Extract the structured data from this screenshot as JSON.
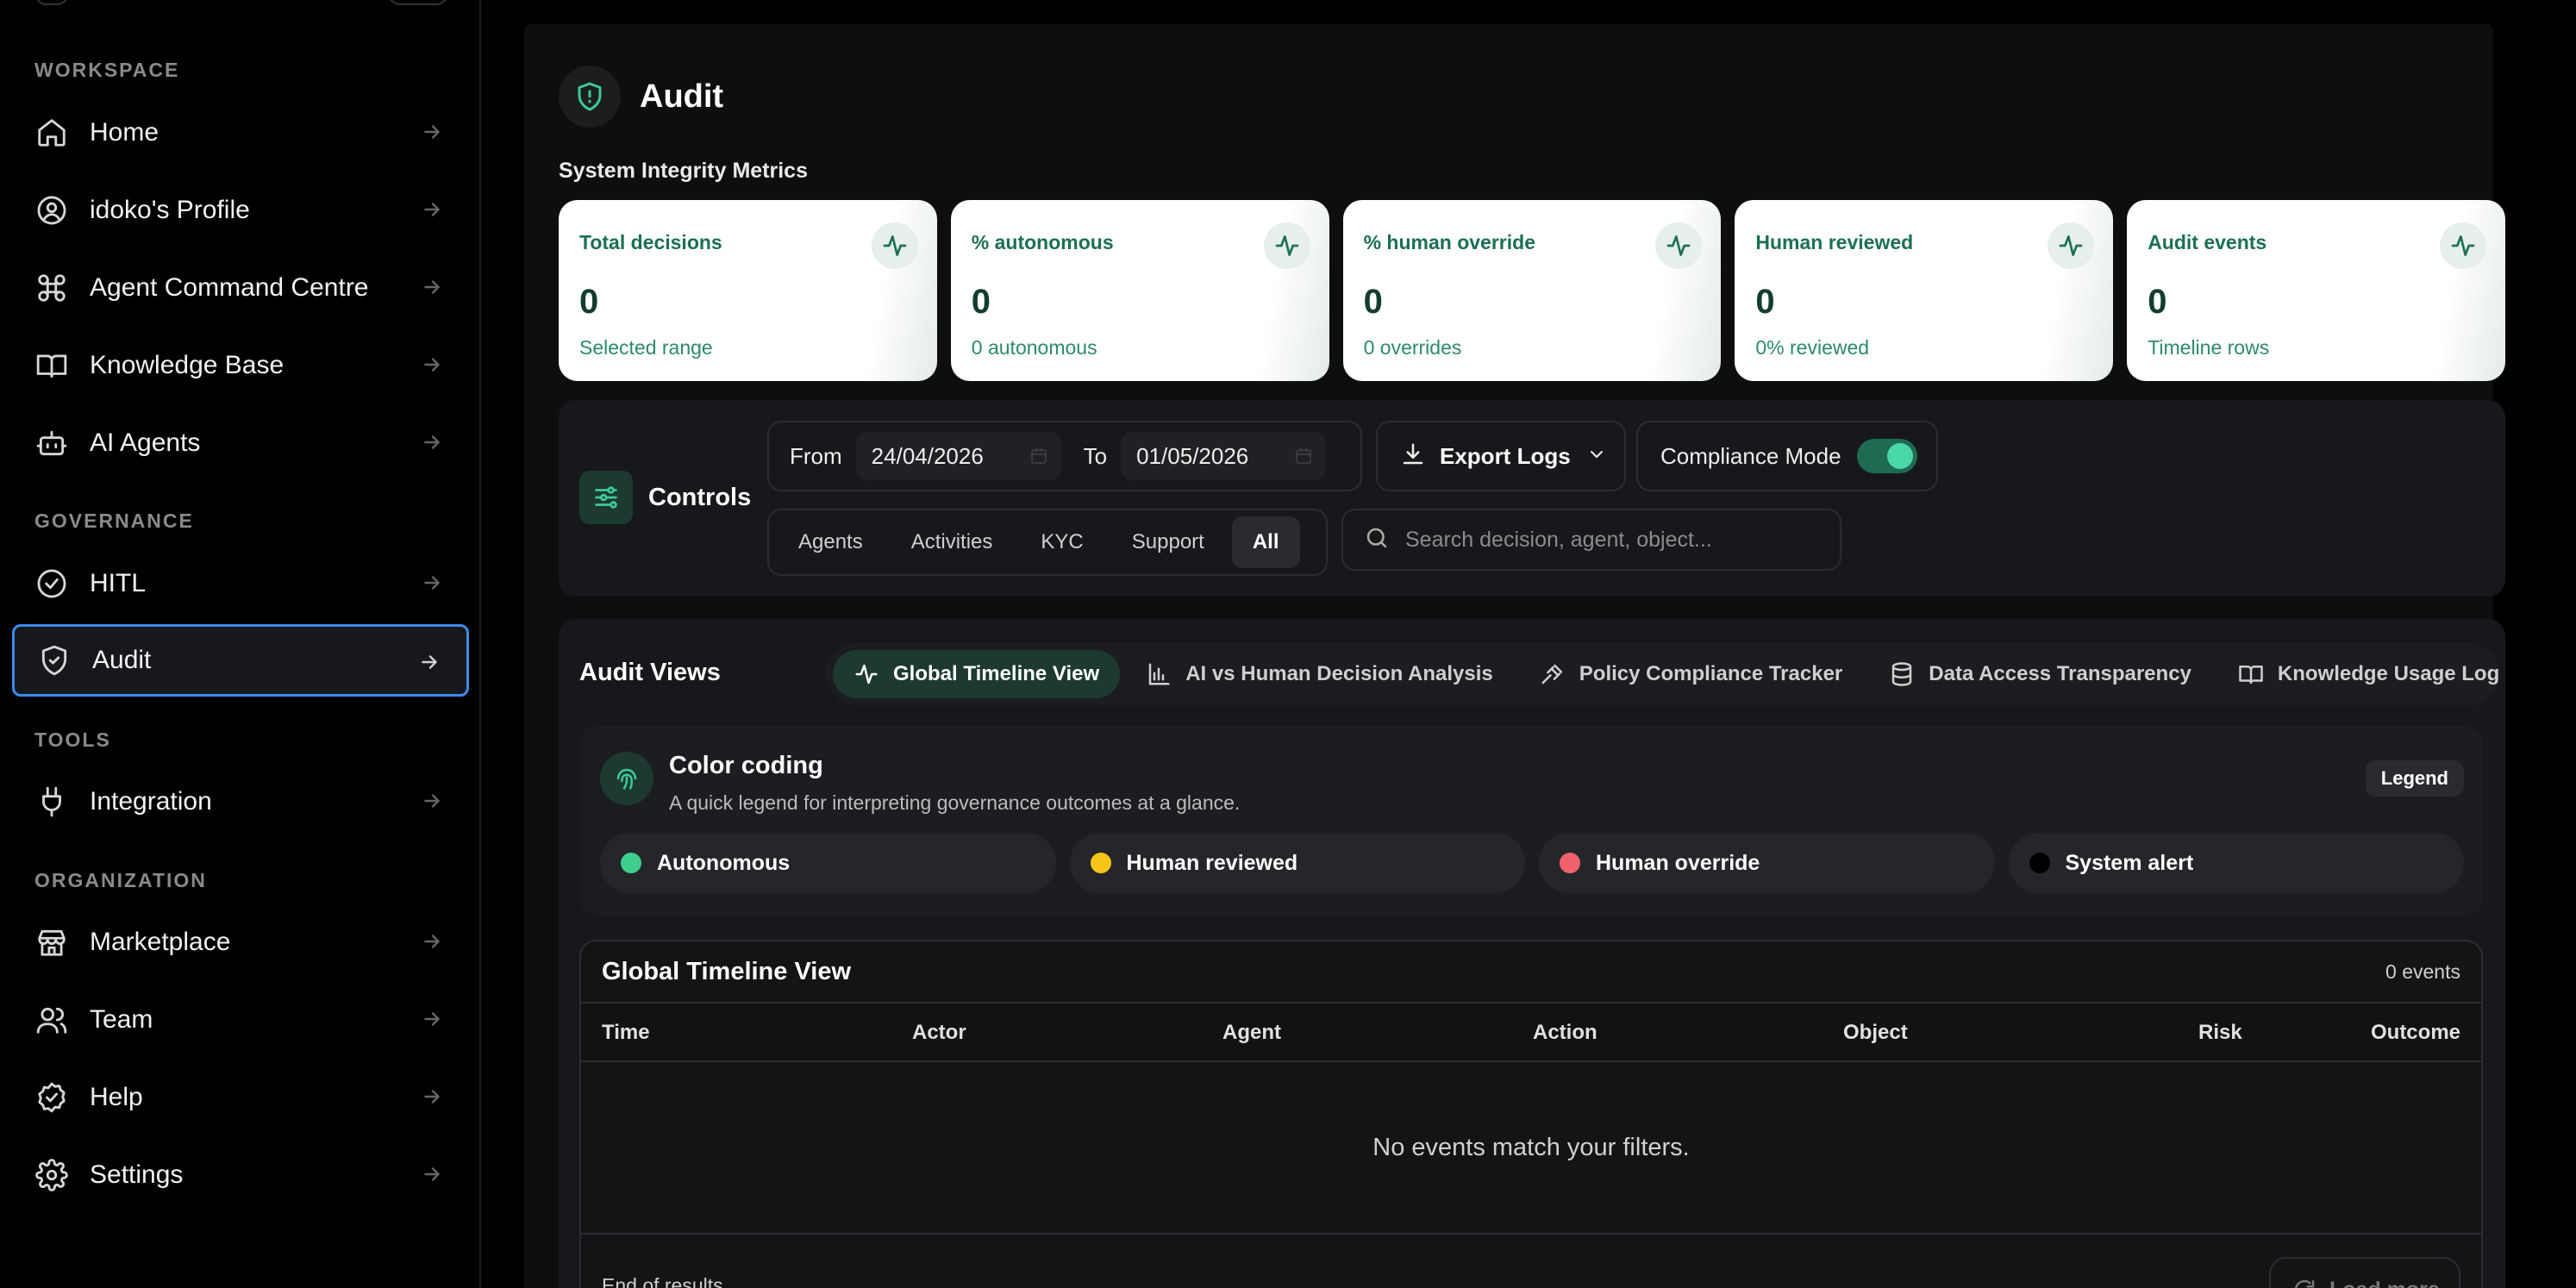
{
  "sidebar": {
    "sections": [
      {
        "title": "WORKSPACE"
      },
      {
        "title": "GOVERNANCE"
      },
      {
        "title": "TOOLS"
      },
      {
        "title": "ORGANIZATION"
      }
    ],
    "items": [
      {
        "label": "Home",
        "icon": "home-icon"
      },
      {
        "label": "idoko's Profile",
        "icon": "user-circle-icon"
      },
      {
        "label": "Agent Command Centre",
        "icon": "command-icon"
      },
      {
        "label": "Knowledge Base",
        "icon": "book-icon"
      },
      {
        "label": "AI Agents",
        "icon": "bot-icon"
      },
      {
        "label": "HITL",
        "icon": "check-circle-icon"
      },
      {
        "label": "Audit",
        "icon": "shield-icon",
        "active": true
      },
      {
        "label": "Integration",
        "icon": "plug-icon"
      },
      {
        "label": "Marketplace",
        "icon": "store-icon"
      },
      {
        "label": "Team",
        "icon": "users-icon"
      },
      {
        "label": "Help",
        "icon": "help-badge-icon"
      },
      {
        "label": "Settings",
        "icon": "gear-icon"
      }
    ]
  },
  "page": {
    "title": "Audit",
    "metrics_title": "System Integrity Metrics"
  },
  "metrics": [
    {
      "label": "Total decisions",
      "value": "0",
      "sub": "Selected range"
    },
    {
      "label": "% autonomous",
      "value": "0",
      "sub": "0 autonomous"
    },
    {
      "label": "% human override",
      "value": "0",
      "sub": "0 overrides"
    },
    {
      "label": "Human reviewed",
      "value": "0",
      "sub": "0% reviewed"
    },
    {
      "label": "Audit events",
      "value": "0",
      "sub": "Timeline rows"
    }
  ],
  "controls": {
    "title": "Controls",
    "from_label": "From",
    "from_value": "24/04/2026",
    "to_label": "To",
    "to_value": "01/05/2026",
    "export_label": "Export Logs",
    "compliance_label": "Compliance Mode",
    "compliance_on": true,
    "filters": [
      "Agents",
      "Activities",
      "KYC",
      "Support",
      "All"
    ],
    "active_filter": "All",
    "search_placeholder": "Search decision, agent, object..."
  },
  "views": {
    "title": "Audit Views",
    "tabs": [
      {
        "label": "Global Timeline View",
        "icon": "activity-icon"
      },
      {
        "label": "AI vs Human Decision Analysis",
        "icon": "bar-chart-icon"
      },
      {
        "label": "Policy Compliance Tracker",
        "icon": "gavel-icon"
      },
      {
        "label": "Data Access Transparency",
        "icon": "database-icon"
      },
      {
        "label": "Knowledge Usage Log",
        "icon": "book-open-icon"
      }
    ],
    "active_tab": "Global Timeline View"
  },
  "legend": {
    "title": "Color coding",
    "subtitle": "A quick legend for interpreting governance outcomes at a glance.",
    "badge": "Legend",
    "items": [
      {
        "label": "Autonomous",
        "color": "#3ecf8e"
      },
      {
        "label": "Human reviewed",
        "color": "#f5c518"
      },
      {
        "label": "Human override",
        "color": "#f0626b"
      },
      {
        "label": "System alert",
        "color": "#000000"
      }
    ]
  },
  "timeline": {
    "title": "Global Timeline View",
    "count": "0 events",
    "columns": [
      "Time",
      "Actor",
      "Agent",
      "Action",
      "Object",
      "Risk",
      "Outcome"
    ],
    "empty": "No events match your filters.",
    "footer": "End of results.",
    "load_more": "Load more"
  }
}
